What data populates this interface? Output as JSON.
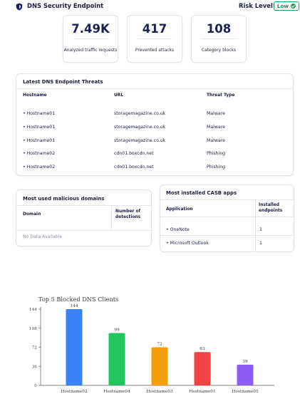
{
  "header": {
    "title": "DNS Security Endpoint",
    "risk_label": "Risk Level:",
    "risk_value": "Low"
  },
  "stats": [
    {
      "value": "7.49K",
      "label": "Analyzed traffic requests"
    },
    {
      "value": "417",
      "label": "Prevented attacks"
    },
    {
      "value": "108",
      "label": "Category blocks"
    }
  ],
  "threats": {
    "title": "Latest DNS Endpoint Threats",
    "columns": [
      "Hostname",
      "URL",
      "Threat Type"
    ],
    "rows": [
      {
        "hostname": "• Hostname01",
        "url": "storagemagazine.co.uk",
        "type": "Malware"
      },
      {
        "hostname": "• Hostname01",
        "url": "storagemagazine.co.uk",
        "type": "Malware"
      },
      {
        "hostname": "• Hostname01",
        "url": "storagemagazine.co.uk",
        "type": "Malware"
      },
      {
        "hostname": "• Hostname02",
        "url": "cdn01.boxcdn.net",
        "type": "Phishing"
      },
      {
        "hostname": "• Hostname02",
        "url": "cdn01.boxcdn.net",
        "type": "Phishing"
      }
    ]
  },
  "malicious_domains": {
    "title": "Most used malicious domains",
    "col_domain": "Domain",
    "col_detections_1": "Number of",
    "col_detections_2": "detections",
    "empty": "No Data Available"
  },
  "casb": {
    "title": "Most installed CASB apps",
    "col_app": "Application",
    "col_installed_1": "Installed",
    "col_installed_2": "endpoints",
    "rows": [
      {
        "app": "• OneNote",
        "count": "1"
      },
      {
        "app": "• Microsoft Outlook",
        "count": "1"
      }
    ]
  },
  "chart_title": "Top 5 Blocked DNS Clients",
  "chart_data": {
    "type": "bar",
    "title": "Top 5 Blocked DNS Clients",
    "categories": [
      "Hostname02",
      "Hostname04",
      "Hostname03",
      "Hostname01",
      "Hostname05"
    ],
    "values": [
      144,
      99,
      72,
      63,
      39
    ],
    "colors": [
      "#3b82f6",
      "#22c55e",
      "#f59e0b",
      "#ef4444",
      "#8b5cf6"
    ],
    "yticks": [
      "0",
      "36",
      "72",
      "108",
      "144"
    ],
    "ylim": [
      0,
      144
    ],
    "grid": false
  },
  "colors": {
    "navy": "#1b2254",
    "risk_green": "#22a05a"
  }
}
